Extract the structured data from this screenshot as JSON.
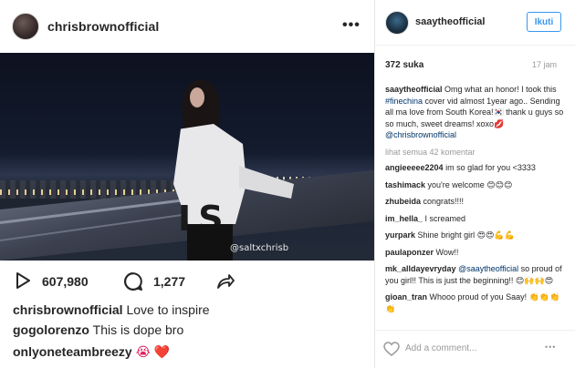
{
  "left": {
    "username": "chrisbrownofficial",
    "more_label": "•••",
    "watermark": "@saltxchrisb",
    "jersey_text": "LS",
    "views": "607,980",
    "comments_count": "1,277",
    "captions": [
      {
        "user": "chrisbrownofficial",
        "text": "Love to inspire"
      },
      {
        "user": "gogolorenzo",
        "text": "This is dope bro"
      },
      {
        "user": "onlyoneteambreezy",
        "text": "😭 ❤️"
      }
    ]
  },
  "right": {
    "username": "saaytheofficial",
    "follow_label": "Ikuti",
    "likes": "372 suka",
    "time": "17 jam",
    "caption_user": "saaytheofficial",
    "caption_pre": "Omg what an honor! I took this ",
    "caption_tag": "#finechina",
    "caption_mid": " cover vid almost 1year ago.. Sending all ma love from South Korea!🇰🇷 thank u guys so so much, sweet dreams! xoxo💋 ",
    "caption_mention": "@chrisbrownofficial",
    "view_all": "lihat semua 42 komentar",
    "comments": [
      {
        "user": "angieeeee2204",
        "pre": "im so glad for you <3333",
        "mention": "",
        "post": ""
      },
      {
        "user": "tashimack",
        "pre": "you're welcome 😊😊😊",
        "mention": "",
        "post": ""
      },
      {
        "user": "zhubeida",
        "pre": "congrats!!!!",
        "mention": "",
        "post": ""
      },
      {
        "user": "im_hella_",
        "pre": "I screamed",
        "mention": "",
        "post": ""
      },
      {
        "user": "yurpark",
        "pre": "Shine bright girl 😍😍💪💪",
        "mention": "",
        "post": ""
      },
      {
        "user": "paulaponzer",
        "pre": "Wow!!",
        "mention": "",
        "post": ""
      },
      {
        "user": "mk_alldayevryday",
        "pre": "",
        "mention": "@saaytheofficial",
        "post": " so proud of you girl!! This is just the beginning!! 😊🙌🙌😍"
      },
      {
        "user": "gioan_tran",
        "pre": "Whooo proud of you Saay! 👏👏👏👏",
        "mention": "",
        "post": ""
      }
    ],
    "add_comment_placeholder": "Add a comment...",
    "footer_more": "•••"
  },
  "icons": {
    "play": "play-icon",
    "comment": "comment-icon",
    "share": "share-icon",
    "heart": "heart-icon"
  },
  "colors": {
    "link": "#003569",
    "accent": "#3897f0",
    "muted": "#999999"
  }
}
